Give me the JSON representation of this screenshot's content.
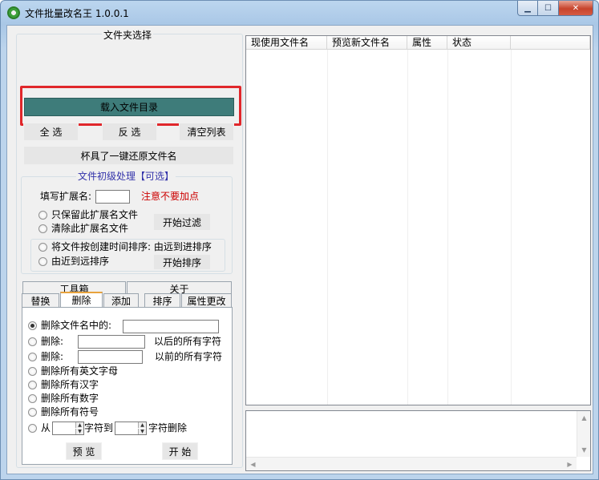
{
  "window": {
    "title": "文件批量改名王  1.0.0.1"
  },
  "folder_group": {
    "title": "文件夹选择",
    "load_button": "载入文件目录",
    "select_all": "全 选",
    "invert": "反 选",
    "clear_list": "清空列表",
    "restore": "杯具了一键还原文件名"
  },
  "basic": {
    "title": "文件初级处理【可选】",
    "ext_label": "填写扩展名:",
    "ext_value": "",
    "warning": "注意不要加点",
    "keep_only": "只保留此扩展名文件",
    "remove": "清除此扩展名文件",
    "start_filter": "开始过滤",
    "sort_far_near": "将文件按创建时间排序: 由远到进排序",
    "sort_near_far": "由近到远排序",
    "start_sort": "开始排序"
  },
  "top_tabs": [
    "工具箱",
    "关于"
  ],
  "sub_tabs": [
    "替换",
    "删除",
    "添加",
    "排序",
    "属性更改"
  ],
  "active_sub_tab": "删除",
  "delete_page": {
    "opt_contains": "删除文件名中的:",
    "opt_after_prefix": "删除:",
    "opt_after_suffix": "以后的所有字符",
    "opt_before_prefix": "删除:",
    "opt_before_suffix": "以前的所有字符",
    "opt_english": "删除所有英文字母",
    "opt_chinese": "删除所有汉字",
    "opt_digits": "删除所有数字",
    "opt_symbols": "删除所有符号",
    "opt_range_from": "从",
    "opt_range_to": "字符到",
    "opt_range_end": "字符删除",
    "preview_button": "预 览",
    "start_button": "开 始"
  },
  "file_list": {
    "columns": [
      "现使用文件名",
      "预览新文件名",
      "属性",
      "状态"
    ],
    "rows": []
  },
  "colors": {
    "accent_button": "#3e7c7a",
    "highlight": "#e0272b",
    "warning_text": "#cc0000",
    "legend_text": "#3333aa"
  },
  "icons": {
    "app": "gear-flower-icon",
    "minimize": "minimize-icon",
    "maximize": "maximize-icon",
    "close": "close-icon"
  }
}
